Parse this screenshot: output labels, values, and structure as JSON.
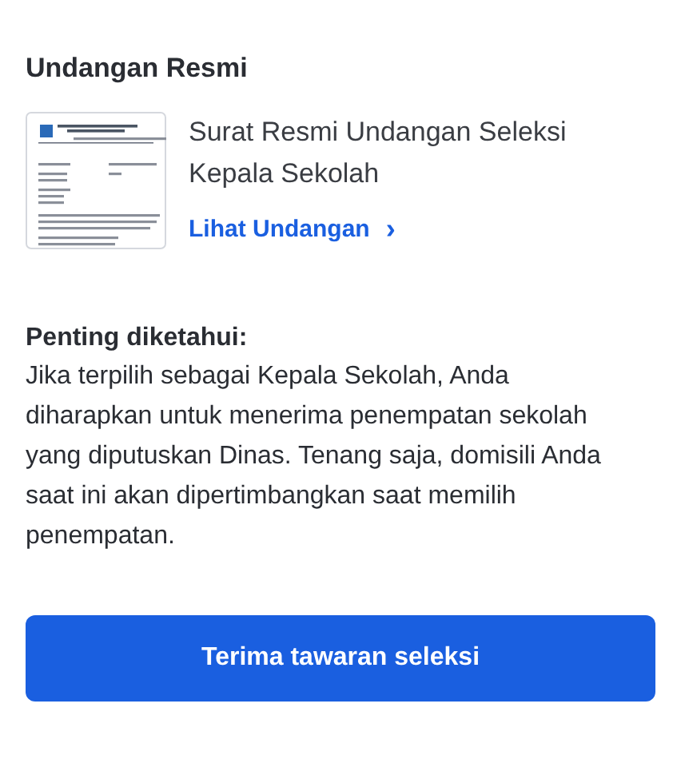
{
  "section_title": "Undangan Resmi",
  "document": {
    "title": "Surat Resmi Undangan Seleksi Kepala Sekolah",
    "link": "Lihat Undangan",
    "link_icon": "›"
  },
  "notice": {
    "heading": "Penting diketahui:",
    "body": "Jika terpilih sebagai Kepala Sekolah, Anda diharapkan untuk menerima penempatan sekolah yang diputuskan Dinas. Tenang saja, domisili Anda saat ini akan dipertimbangkan saat memilih penempatan."
  },
  "button": {
    "label": "Terima tawaran seleksi"
  }
}
